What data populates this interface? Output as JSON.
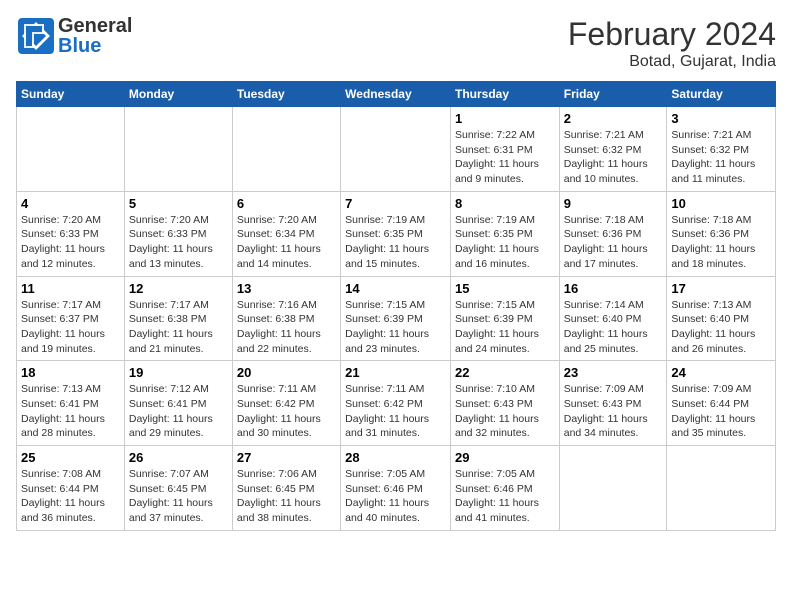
{
  "header": {
    "logo_general": "General",
    "logo_blue": "Blue",
    "month_title": "February 2024",
    "location": "Botad, Gujarat, India"
  },
  "days_of_week": [
    "Sunday",
    "Monday",
    "Tuesday",
    "Wednesday",
    "Thursday",
    "Friday",
    "Saturday"
  ],
  "weeks": [
    [
      {
        "day": "",
        "info": ""
      },
      {
        "day": "",
        "info": ""
      },
      {
        "day": "",
        "info": ""
      },
      {
        "day": "",
        "info": ""
      },
      {
        "day": "1",
        "info": "Sunrise: 7:22 AM\nSunset: 6:31 PM\nDaylight: 11 hours and 9 minutes."
      },
      {
        "day": "2",
        "info": "Sunrise: 7:21 AM\nSunset: 6:32 PM\nDaylight: 11 hours and 10 minutes."
      },
      {
        "day": "3",
        "info": "Sunrise: 7:21 AM\nSunset: 6:32 PM\nDaylight: 11 hours and 11 minutes."
      }
    ],
    [
      {
        "day": "4",
        "info": "Sunrise: 7:20 AM\nSunset: 6:33 PM\nDaylight: 11 hours and 12 minutes."
      },
      {
        "day": "5",
        "info": "Sunrise: 7:20 AM\nSunset: 6:33 PM\nDaylight: 11 hours and 13 minutes."
      },
      {
        "day": "6",
        "info": "Sunrise: 7:20 AM\nSunset: 6:34 PM\nDaylight: 11 hours and 14 minutes."
      },
      {
        "day": "7",
        "info": "Sunrise: 7:19 AM\nSunset: 6:35 PM\nDaylight: 11 hours and 15 minutes."
      },
      {
        "day": "8",
        "info": "Sunrise: 7:19 AM\nSunset: 6:35 PM\nDaylight: 11 hours and 16 minutes."
      },
      {
        "day": "9",
        "info": "Sunrise: 7:18 AM\nSunset: 6:36 PM\nDaylight: 11 hours and 17 minutes."
      },
      {
        "day": "10",
        "info": "Sunrise: 7:18 AM\nSunset: 6:36 PM\nDaylight: 11 hours and 18 minutes."
      }
    ],
    [
      {
        "day": "11",
        "info": "Sunrise: 7:17 AM\nSunset: 6:37 PM\nDaylight: 11 hours and 19 minutes."
      },
      {
        "day": "12",
        "info": "Sunrise: 7:17 AM\nSunset: 6:38 PM\nDaylight: 11 hours and 21 minutes."
      },
      {
        "day": "13",
        "info": "Sunrise: 7:16 AM\nSunset: 6:38 PM\nDaylight: 11 hours and 22 minutes."
      },
      {
        "day": "14",
        "info": "Sunrise: 7:15 AM\nSunset: 6:39 PM\nDaylight: 11 hours and 23 minutes."
      },
      {
        "day": "15",
        "info": "Sunrise: 7:15 AM\nSunset: 6:39 PM\nDaylight: 11 hours and 24 minutes."
      },
      {
        "day": "16",
        "info": "Sunrise: 7:14 AM\nSunset: 6:40 PM\nDaylight: 11 hours and 25 minutes."
      },
      {
        "day": "17",
        "info": "Sunrise: 7:13 AM\nSunset: 6:40 PM\nDaylight: 11 hours and 26 minutes."
      }
    ],
    [
      {
        "day": "18",
        "info": "Sunrise: 7:13 AM\nSunset: 6:41 PM\nDaylight: 11 hours and 28 minutes."
      },
      {
        "day": "19",
        "info": "Sunrise: 7:12 AM\nSunset: 6:41 PM\nDaylight: 11 hours and 29 minutes."
      },
      {
        "day": "20",
        "info": "Sunrise: 7:11 AM\nSunset: 6:42 PM\nDaylight: 11 hours and 30 minutes."
      },
      {
        "day": "21",
        "info": "Sunrise: 7:11 AM\nSunset: 6:42 PM\nDaylight: 11 hours and 31 minutes."
      },
      {
        "day": "22",
        "info": "Sunrise: 7:10 AM\nSunset: 6:43 PM\nDaylight: 11 hours and 32 minutes."
      },
      {
        "day": "23",
        "info": "Sunrise: 7:09 AM\nSunset: 6:43 PM\nDaylight: 11 hours and 34 minutes."
      },
      {
        "day": "24",
        "info": "Sunrise: 7:09 AM\nSunset: 6:44 PM\nDaylight: 11 hours and 35 minutes."
      }
    ],
    [
      {
        "day": "25",
        "info": "Sunrise: 7:08 AM\nSunset: 6:44 PM\nDaylight: 11 hours and 36 minutes."
      },
      {
        "day": "26",
        "info": "Sunrise: 7:07 AM\nSunset: 6:45 PM\nDaylight: 11 hours and 37 minutes."
      },
      {
        "day": "27",
        "info": "Sunrise: 7:06 AM\nSunset: 6:45 PM\nDaylight: 11 hours and 38 minutes."
      },
      {
        "day": "28",
        "info": "Sunrise: 7:05 AM\nSunset: 6:46 PM\nDaylight: 11 hours and 40 minutes."
      },
      {
        "day": "29",
        "info": "Sunrise: 7:05 AM\nSunset: 6:46 PM\nDaylight: 11 hours and 41 minutes."
      },
      {
        "day": "",
        "info": ""
      },
      {
        "day": "",
        "info": ""
      }
    ]
  ]
}
